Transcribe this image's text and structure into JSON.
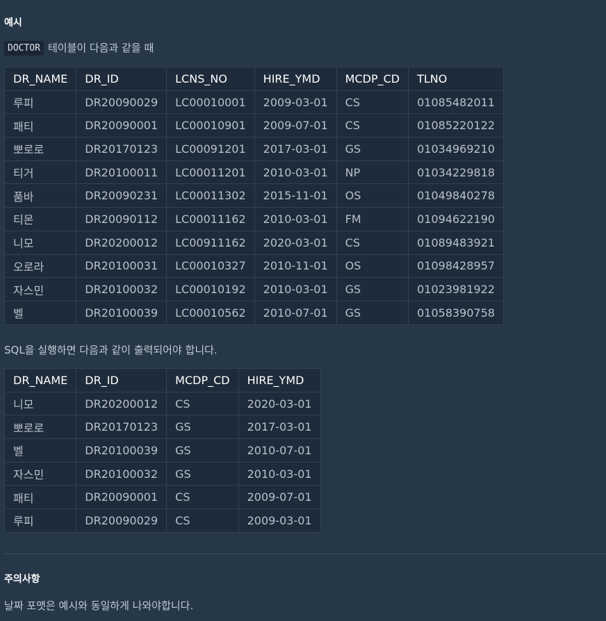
{
  "example_heading": "예시",
  "intro": {
    "code": "DOCTOR",
    "text": "테이블이 다음과 같을 때"
  },
  "doctor_table": {
    "columns": [
      "DR_NAME",
      "DR_ID",
      "LCNS_NO",
      "HIRE_YMD",
      "MCDP_CD",
      "TLNO"
    ],
    "rows": [
      [
        "루피",
        "DR20090029",
        "LC00010001",
        "2009-03-01",
        "CS",
        "01085482011"
      ],
      [
        "패티",
        "DR20090001",
        "LC00010901",
        "2009-07-01",
        "CS",
        "01085220122"
      ],
      [
        "뽀로로",
        "DR20170123",
        "LC00091201",
        "2017-03-01",
        "GS",
        "01034969210"
      ],
      [
        "티거",
        "DR20100011",
        "LC00011201",
        "2010-03-01",
        "NP",
        "01034229818"
      ],
      [
        "품바",
        "DR20090231",
        "LC00011302",
        "2015-11-01",
        "OS",
        "01049840278"
      ],
      [
        "티몬",
        "DR20090112",
        "LC00011162",
        "2010-03-01",
        "FM",
        "01094622190"
      ],
      [
        "니모",
        "DR20200012",
        "LC00911162",
        "2020-03-01",
        "CS",
        "01089483921"
      ],
      [
        "오로라",
        "DR20100031",
        "LC00010327",
        "2010-11-01",
        "OS",
        "01098428957"
      ],
      [
        "자스민",
        "DR20100032",
        "LC00010192",
        "2010-03-01",
        "GS",
        "01023981922"
      ],
      [
        "벨",
        "DR20100039",
        "LC00010562",
        "2010-07-01",
        "GS",
        "01058390758"
      ]
    ]
  },
  "result_intro": "SQL을 실행하면 다음과 같이 출력되어야 합니다.",
  "result_table": {
    "columns": [
      "DR_NAME",
      "DR_ID",
      "MCDP_CD",
      "HIRE_YMD"
    ],
    "rows": [
      [
        "니모",
        "DR20200012",
        "CS",
        "2020-03-01"
      ],
      [
        "뽀로로",
        "DR20170123",
        "GS",
        "2017-03-01"
      ],
      [
        "벨",
        "DR20100039",
        "GS",
        "2010-07-01"
      ],
      [
        "자스민",
        "DR20100032",
        "GS",
        "2010-03-01"
      ],
      [
        "패티",
        "DR20090001",
        "CS",
        "2009-07-01"
      ],
      [
        "루피",
        "DR20090029",
        "CS",
        "2009-03-01"
      ]
    ]
  },
  "notes_heading": "주의사항",
  "notes_text": "날짜 포맷은 예시와 동일하게 나와야합니다."
}
